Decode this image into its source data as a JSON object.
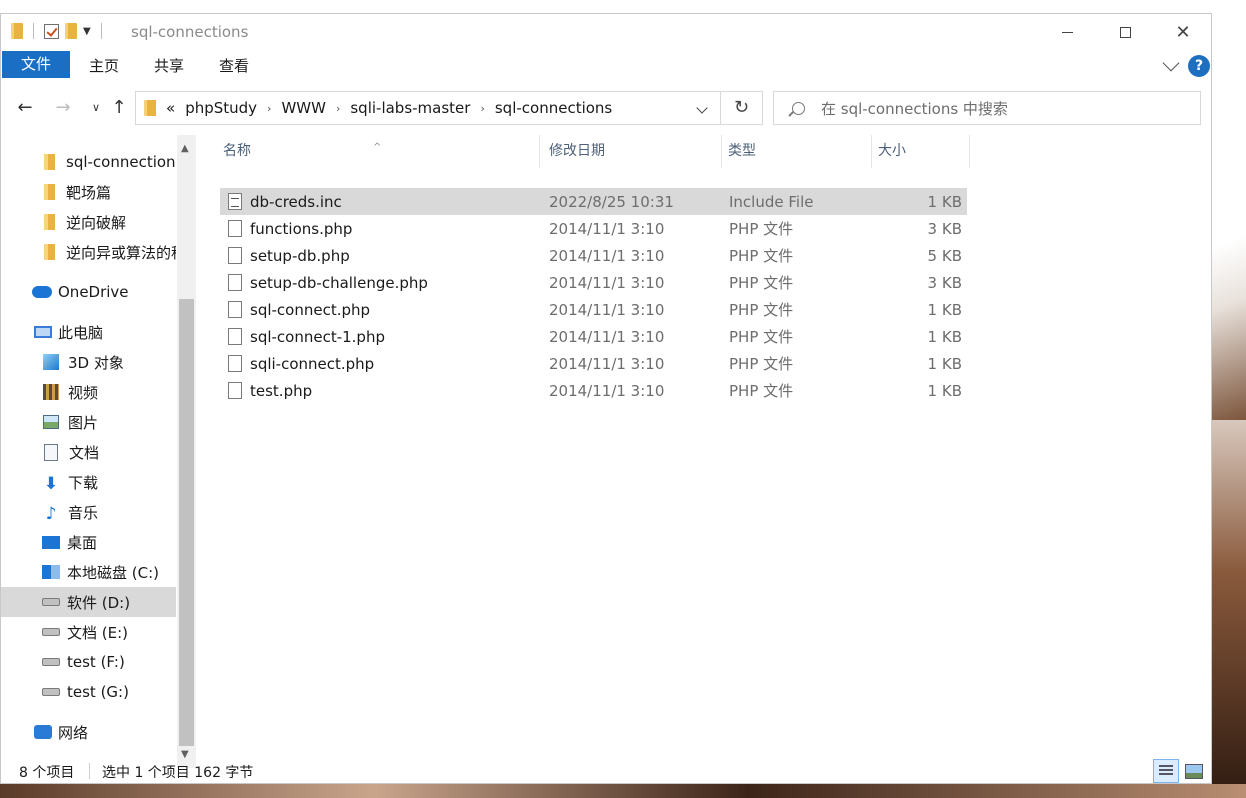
{
  "window": {
    "title": "sql-connections",
    "minimize": "minimize",
    "maximize": "maximize",
    "close": "✕"
  },
  "ribbon": {
    "tabs": [
      "文件",
      "主页",
      "共享",
      "查看"
    ],
    "help": "?"
  },
  "nav": {
    "back": "←",
    "forward": "→",
    "up": "↑",
    "recent": "∨",
    "overflow": "«",
    "breadcrumb": [
      "phpStudy",
      "WWW",
      "sqli-labs-master",
      "sql-connections"
    ],
    "refresh": "↻"
  },
  "search": {
    "placeholder": "在 sql-connections 中搜索"
  },
  "sidebar": {
    "items": [
      {
        "label": "sql-connections",
        "icon": "folder-icon"
      },
      {
        "label": "靶场篇",
        "icon": "folder-icon"
      },
      {
        "label": "逆向破解",
        "icon": "folder-icon"
      },
      {
        "label": "逆向异或算法的程序",
        "icon": "folder-icon"
      },
      {
        "label": "OneDrive",
        "icon": "onedrive-icon"
      },
      {
        "label": "此电脑",
        "icon": "pc-icon"
      },
      {
        "label": "3D 对象",
        "icon": "3d-objects-icon"
      },
      {
        "label": "视频",
        "icon": "video-icon"
      },
      {
        "label": "图片",
        "icon": "pictures-icon"
      },
      {
        "label": "文档",
        "icon": "documents-icon"
      },
      {
        "label": "下载",
        "icon": "download-icon"
      },
      {
        "label": "音乐",
        "icon": "music-icon"
      },
      {
        "label": "桌面",
        "icon": "desktop-icon"
      },
      {
        "label": "本地磁盘 (C:)",
        "icon": "system-drive-icon"
      },
      {
        "label": "软件 (D:)",
        "icon": "drive-icon"
      },
      {
        "label": "文档 (E:)",
        "icon": "drive-icon"
      },
      {
        "label": "test (F:)",
        "icon": "drive-icon"
      },
      {
        "label": "test (G:)",
        "icon": "drive-icon"
      },
      {
        "label": "网络",
        "icon": "network-icon"
      }
    ],
    "selected": "软件 (D:)"
  },
  "list": {
    "columns": [
      "名称",
      "修改日期",
      "类型",
      "大小"
    ],
    "rows": [
      {
        "name": "db-creds.inc",
        "date": "2022/8/25 10:31",
        "type": "Include File",
        "size": "1 KB",
        "selected": true
      },
      {
        "name": "functions.php",
        "date": "2014/11/1 3:10",
        "type": "PHP 文件",
        "size": "3 KB"
      },
      {
        "name": "setup-db.php",
        "date": "2014/11/1 3:10",
        "type": "PHP 文件",
        "size": "5 KB"
      },
      {
        "name": "setup-db-challenge.php",
        "date": "2014/11/1 3:10",
        "type": "PHP 文件",
        "size": "3 KB"
      },
      {
        "name": "sql-connect.php",
        "date": "2014/11/1 3:10",
        "type": "PHP 文件",
        "size": "1 KB"
      },
      {
        "name": "sql-connect-1.php",
        "date": "2014/11/1 3:10",
        "type": "PHP 文件",
        "size": "1 KB"
      },
      {
        "name": "sqli-connect.php",
        "date": "2014/11/1 3:10",
        "type": "PHP 文件",
        "size": "1 KB"
      },
      {
        "name": "test.php",
        "date": "2014/11/1 3:10",
        "type": "PHP 文件",
        "size": "1 KB"
      }
    ]
  },
  "status": {
    "count": "8 个项目",
    "selection": "选中 1 个项目  162 字节"
  },
  "colors": {
    "accent": "#1a6fc4",
    "selection": "#d9d9d9"
  }
}
